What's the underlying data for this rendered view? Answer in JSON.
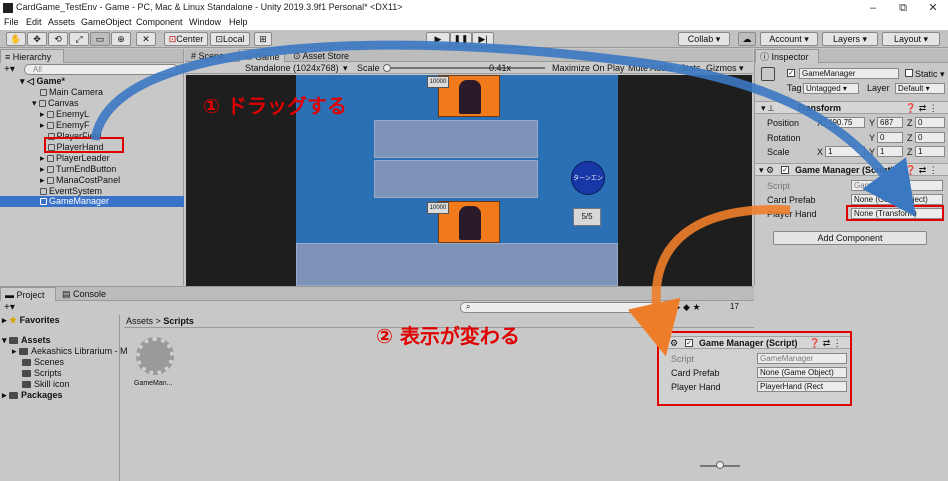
{
  "window": {
    "title": "CardGame_TestEnv - Game - PC, Mac & Linux Standalone - Unity 2019.3.9f1 Personal* <DX11>",
    "minimize": "–",
    "maximize": "⧉",
    "close": "✕"
  },
  "menu": [
    "File",
    "Edit",
    "Assets",
    "GameObject",
    "Component",
    "Window",
    "Help"
  ],
  "toolbar": {
    "center": "Center",
    "local": "Local",
    "collab": "Collab ▾",
    "account": "Account ▾",
    "layers": "Layers ▾",
    "layout": "Layout ▾"
  },
  "hierarchy": {
    "tab": "Hierarchy",
    "search_placeholder": "All",
    "items": [
      {
        "label": "Game*"
      },
      {
        "label": "Main Camera"
      },
      {
        "label": "Canvas"
      },
      {
        "label": "EnemyL"
      },
      {
        "label": "EnemyF"
      },
      {
        "label": "PlayerField"
      },
      {
        "label": "PlayerHand"
      },
      {
        "label": "PlayerLeader"
      },
      {
        "label": "TurnEndButton"
      },
      {
        "label": "ManaCostPanel"
      },
      {
        "label": "EventSystem"
      },
      {
        "label": "GameManager"
      }
    ]
  },
  "game_view": {
    "tab_scene": "Scene",
    "tab_game": "Game",
    "tab_asset_store": "Asset Store",
    "resolution": "Standalone (1024x768)",
    "scale_label": "Scale",
    "scale_value": "0.41x",
    "maximize_on_play": "Maximize On Play",
    "mute_audio": "Mute Audio",
    "stats": "Stats",
    "gizmos": "Gizmos ▾",
    "enemy_card_cost": "10000",
    "player_card_cost": "10000",
    "turn_end": "ターンエンド",
    "mana": "5/5"
  },
  "annotations": {
    "step1": "① ドラッグする",
    "step2": "② 表示が変わる"
  },
  "inspector": {
    "tab": "Inspector",
    "object_name": "GameManager",
    "static_label": "Static ▾",
    "tag_label": "Tag",
    "tag_value": "Untagged ▾",
    "layer_label": "Layer",
    "layer_value": "Default ▾",
    "transform": {
      "title": "Transform",
      "position_label": "Position",
      "rotation_label": "Rotation",
      "scale_label": "Scale",
      "pos_x": "490.75",
      "pos_y": "687",
      "pos_z": "0",
      "rot_x": "",
      "rot_y": "0",
      "rot_z": "0",
      "scl_x": "1",
      "scl_y": "1",
      "scl_z": "1"
    },
    "game_manager": {
      "title": "Game Manager (Script)",
      "script_label": "Script",
      "script_value": "GameManager",
      "card_prefab_label": "Card Prefab",
      "card_prefab_value": "None (Game Object)",
      "player_hand_label": "Player Hand",
      "player_hand_value": "None (Transform)"
    },
    "add_component": "Add Component"
  },
  "after_panel": {
    "title": "Game Manager (Script)",
    "script_label": "Script",
    "script_value": "GameManager",
    "card_prefab_label": "Card Prefab",
    "card_prefab_value": "None (Game Object)",
    "player_hand_label": "Player Hand",
    "player_hand_value": "PlayerHand (Rect"
  },
  "project": {
    "tab_project": "Project",
    "tab_console": "Console",
    "favorites": "Favorites",
    "assets": "Assets",
    "asset_folders": [
      "Aekashics Librarium - M",
      "Scenes",
      "Scripts",
      "Skill icon"
    ],
    "packages": "Packages",
    "breadcrumb_root": "Assets",
    "breadcrumb_sep": ">",
    "breadcrumb_current": "Scripts",
    "file_name": "GameMan...",
    "count": "17"
  }
}
